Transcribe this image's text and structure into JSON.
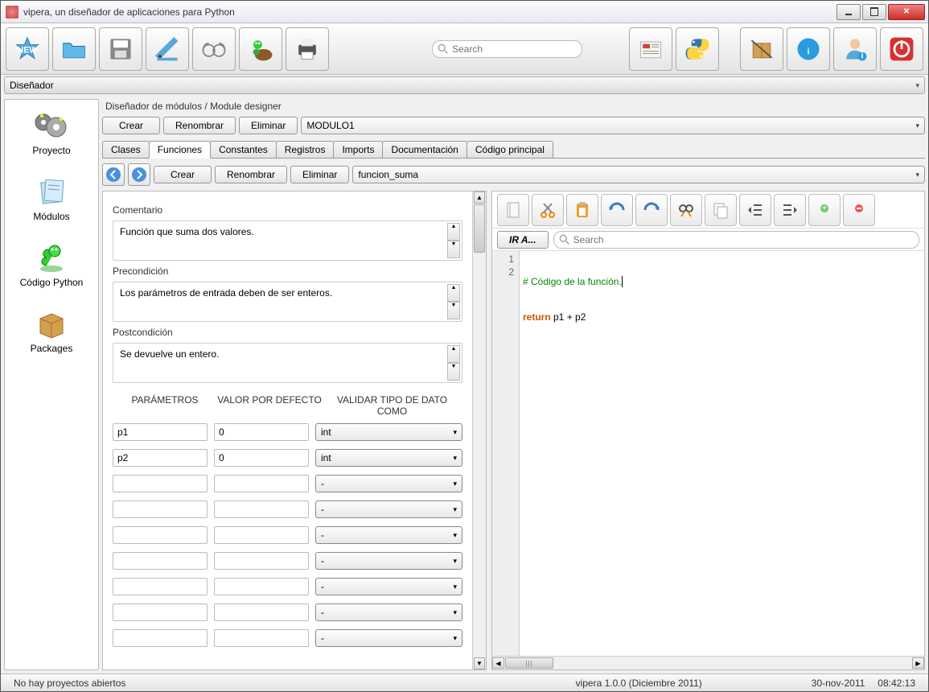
{
  "window": {
    "title": "vipera, un diseñador de aplicaciones para Python"
  },
  "search_placeholder": "Search",
  "designer_dropdown": "Diseñador",
  "leftnav": {
    "proyecto": "Proyecto",
    "modulos": "Módulos",
    "codigo": "Código Python",
    "packages": "Packages"
  },
  "module_designer": {
    "header": "Diseñador de módulos / Module designer",
    "crear": "Crear",
    "renombrar": "Renombrar",
    "eliminar": "Eliminar",
    "module_name": "MODULO1"
  },
  "tabs": {
    "clases": "Clases",
    "funciones": "Funciones",
    "constantes": "Constantes",
    "registros": "Registros",
    "imports": "Imports",
    "documentacion": "Documentación",
    "codigo_principal": "Código principal"
  },
  "func_toolbar": {
    "crear": "Crear",
    "renombrar": "Renombrar",
    "eliminar": "Eliminar",
    "name": "funcion_suma"
  },
  "form": {
    "comentario_label": "Comentario",
    "comentario": "Función que suma dos valores.",
    "precond_label": "Precondición",
    "precond": "Los parámetros de entrada deben de ser enteros.",
    "postcond_label": "Postcondición",
    "postcond": "Se devuelve un entero.",
    "col_param": "PARÁMETROS",
    "col_default": "VALOR POR DEFECTO",
    "col_validate": "VALIDAR TIPO DE DATO COMO",
    "rows": [
      {
        "p": "p1",
        "d": "0",
        "v": "int"
      },
      {
        "p": "p2",
        "d": "0",
        "v": "int"
      },
      {
        "p": "",
        "d": "",
        "v": "-"
      },
      {
        "p": "",
        "d": "",
        "v": "-"
      },
      {
        "p": "",
        "d": "",
        "v": "-"
      },
      {
        "p": "",
        "d": "",
        "v": "-"
      },
      {
        "p": "",
        "d": "",
        "v": "-"
      },
      {
        "p": "",
        "d": "",
        "v": "-"
      },
      {
        "p": "",
        "d": "",
        "v": "-"
      }
    ]
  },
  "editor": {
    "ira": "IR A...",
    "search_placeholder": "Search",
    "lines": [
      {
        "n": "1",
        "comment": "# Código de la función."
      },
      {
        "n": "2",
        "kw": "return",
        "rest": " p1 + p2"
      }
    ]
  },
  "status": {
    "left": "No hay proyectos abiertos",
    "center": "vipera 1.0.0 (Diciembre 2011)",
    "date": "30-nov-2011",
    "time": "08:42:13"
  }
}
